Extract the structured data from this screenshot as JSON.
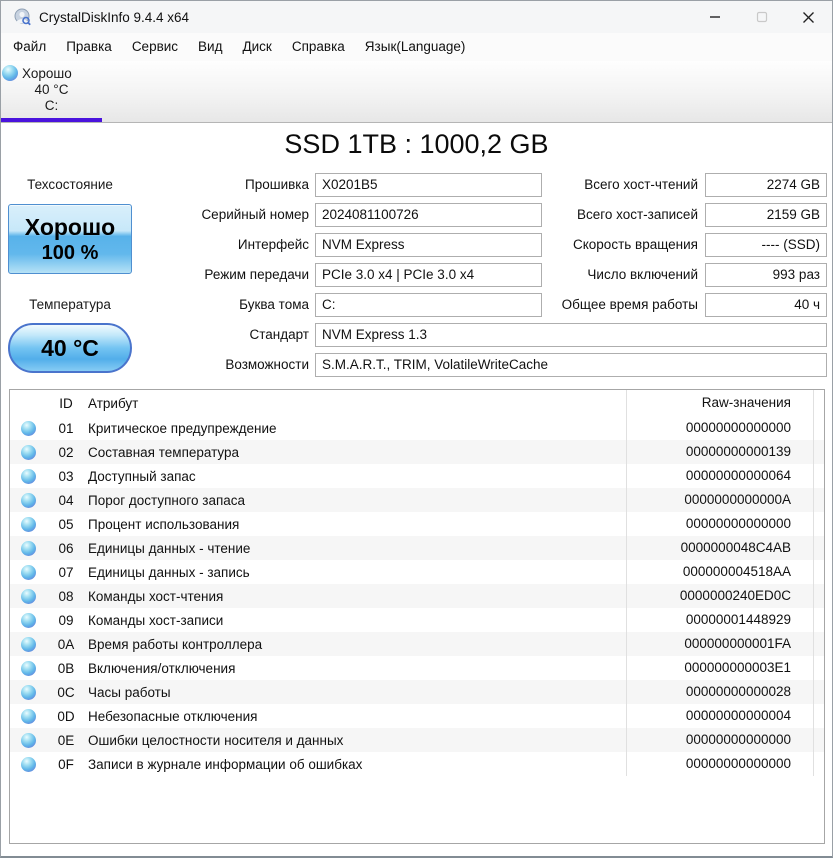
{
  "window": {
    "title": "CrystalDiskInfo 9.4.4 x64"
  },
  "menu": {
    "items": [
      "Файл",
      "Правка",
      "Сервис",
      "Вид",
      "Диск",
      "Справка",
      "Язык(Language)"
    ]
  },
  "drive_tab": {
    "status": "Хорошо",
    "temperature": "40 °C",
    "volume": "C:"
  },
  "disk_title": "SSD 1TB : 1000,2 GB",
  "health": {
    "label": "Техсостояние",
    "status": "Хорошо",
    "percent": "100 %"
  },
  "temperature": {
    "label": "Температура",
    "value": "40 °C"
  },
  "info": {
    "center": [
      {
        "label": "Прошивка",
        "value": "X0201B5"
      },
      {
        "label": "Серийный номер",
        "value": "2024081100726"
      },
      {
        "label": "Интерфейс",
        "value": "NVM Express"
      },
      {
        "label": "Режим передачи",
        "value": "PCIe 3.0 x4 | PCIe 3.0 x4"
      },
      {
        "label": "Буква тома",
        "value": "C:"
      }
    ],
    "wide": [
      {
        "label": "Стандарт",
        "value": "NVM Express 1.3"
      },
      {
        "label": "Возможности",
        "value": "S.M.A.R.T., TRIM, VolatileWriteCache"
      }
    ],
    "right": [
      {
        "label": "Всего хост-чтений",
        "value": "2274 GB"
      },
      {
        "label": "Всего хост-записей",
        "value": "2159 GB"
      },
      {
        "label": "Скорость вращения",
        "value": "---- (SSD)"
      },
      {
        "label": "Число включений",
        "value": "993 раз"
      },
      {
        "label": "Общее время работы",
        "value": "40 ч"
      }
    ]
  },
  "smart": {
    "headers": {
      "id": "ID",
      "attribute": "Атрибут",
      "raw": "Raw-значения"
    },
    "rows": [
      {
        "id": "01",
        "attribute": "Критическое предупреждение",
        "raw": "00000000000000"
      },
      {
        "id": "02",
        "attribute": "Составная температура",
        "raw": "00000000000139"
      },
      {
        "id": "03",
        "attribute": "Доступный запас",
        "raw": "00000000000064"
      },
      {
        "id": "04",
        "attribute": "Порог доступного запаса",
        "raw": "0000000000000A"
      },
      {
        "id": "05",
        "attribute": "Процент использования",
        "raw": "00000000000000"
      },
      {
        "id": "06",
        "attribute": "Единицы данных - чтение",
        "raw": "0000000048C4AB"
      },
      {
        "id": "07",
        "attribute": "Единицы данных - запись",
        "raw": "000000004518AA"
      },
      {
        "id": "08",
        "attribute": "Команды хост-чтения",
        "raw": "0000000240ED0C"
      },
      {
        "id": "09",
        "attribute": "Команды хост-записи",
        "raw": "00000001448929"
      },
      {
        "id": "0A",
        "attribute": "Время работы контроллера",
        "raw": "000000000001FA"
      },
      {
        "id": "0B",
        "attribute": "Включения/отключения",
        "raw": "000000000003E1"
      },
      {
        "id": "0C",
        "attribute": "Часы работы",
        "raw": "00000000000028"
      },
      {
        "id": "0D",
        "attribute": "Небезопасные отключения",
        "raw": "00000000000004"
      },
      {
        "id": "0E",
        "attribute": "Ошибки целостности носителя и данных",
        "raw": "00000000000000"
      },
      {
        "id": "0F",
        "attribute": "Записи в журнале информации об ошибках",
        "raw": "00000000000000"
      }
    ]
  },
  "icons": {
    "app": "crystaldiskinfo-logo",
    "status_orb": "blue-health-orb",
    "minimize": "minimize-glyph",
    "maximize": "maximize-glyph",
    "close": "close-glyph"
  },
  "colors": {
    "tab_accent": "#4a13dd",
    "health_fill": "#58b2ea",
    "orb_blue": "#6a68d8",
    "stripe": "#f6f6f6"
  }
}
